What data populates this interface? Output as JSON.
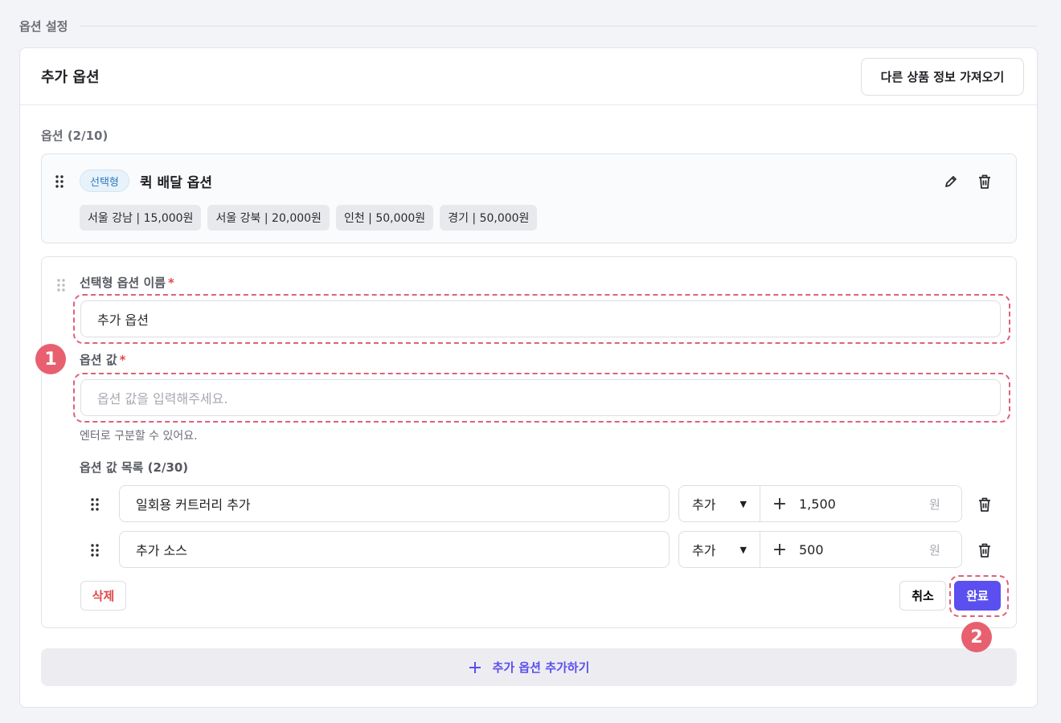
{
  "section": {
    "title": "옵션 설정"
  },
  "card": {
    "title": "추가 옵션",
    "import_button": "다른 상품 정보 가져오기",
    "options_count": "옵션 (2/10)"
  },
  "saved_option": {
    "type_badge": "선택형",
    "name": "퀵 배달 옵션",
    "icons": {
      "edit": "pencil-icon",
      "delete": "trash-icon",
      "drag": "drag-handle-icon"
    },
    "values": [
      "서울 강남 | 15,000원",
      "서울 강북 | 20,000원",
      "인천 | 50,000원",
      "경기 | 50,000원"
    ]
  },
  "editor": {
    "name_label": "선택형 옵션 이름",
    "required_mark": "*",
    "name_value": "추가 옵션",
    "value_label": "옵션 값",
    "value_placeholder": "옵션 값을 입력해주세요.",
    "helper": "엔터로 구분할 수 있어요.",
    "list_label": "옵션 값 목록 (2/30)",
    "rows": [
      {
        "name": "일회용 커트러리 추가",
        "mode": "추가",
        "sign": "+",
        "price": "1,500",
        "unit": "원"
      },
      {
        "name": "추가 소스",
        "mode": "추가",
        "sign": "+",
        "price": "500",
        "unit": "원"
      }
    ],
    "delete_button": "삭제",
    "cancel_button": "취소",
    "done_button": "완료"
  },
  "markers": [
    "1",
    "2"
  ],
  "add_option_button": "추가 옵션 추가하기",
  "colors": {
    "accent": "#5b4ff0",
    "danger": "#e04a4a",
    "marker": "#e8606f",
    "badge": "#2f79c0"
  }
}
